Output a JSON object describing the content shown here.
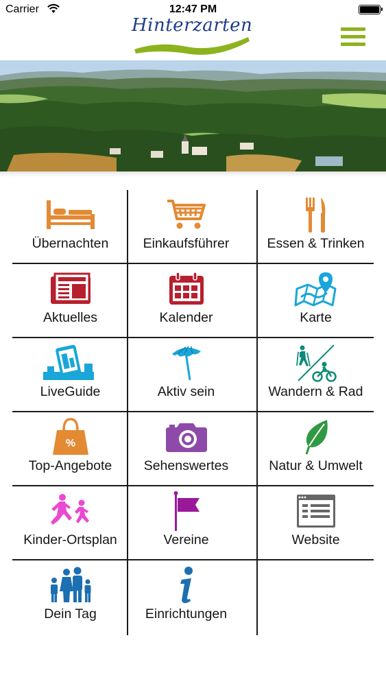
{
  "status_bar": {
    "carrier": "Carrier",
    "time": "12:47 PM"
  },
  "header": {
    "logo_text": "Hinterzarten"
  },
  "colors": {
    "accent_green": "#8cb31d",
    "logo_blue": "#1f3b8a",
    "orange": "#e38a33",
    "red": "#b7202e",
    "cyan": "#1aa6d8",
    "teal": "#0e8a7a",
    "purple": "#8e4aa8",
    "leaf_green": "#2f9a42",
    "pink": "#e94ad1",
    "magenta": "#9a199b",
    "gray": "#666666",
    "blue": "#1c6fb0"
  },
  "menu_items": [
    {
      "label": "Übernachten",
      "icon": "bed-icon"
    },
    {
      "label": "Einkaufsführer",
      "icon": "shopping-cart-icon"
    },
    {
      "label": "Essen & Trinken",
      "icon": "fork-knife-icon"
    },
    {
      "label": "Aktuelles",
      "icon": "newspaper-icon"
    },
    {
      "label": "Kalender",
      "icon": "calendar-icon"
    },
    {
      "label": "Karte",
      "icon": "map-pin-icon"
    },
    {
      "label": "LiveGuide",
      "icon": "phone-city-icon"
    },
    {
      "label": "Aktiv sein",
      "icon": "parasol-icon"
    },
    {
      "label": "Wandern & Rad",
      "icon": "hiker-cyclist-icon"
    },
    {
      "label": "Top-Angebote",
      "icon": "shopping-bag-percent-icon"
    },
    {
      "label": "Sehenswertes",
      "icon": "camera-icon"
    },
    {
      "label": "Natur & Umwelt",
      "icon": "leaf-icon"
    },
    {
      "label": "Kinder-Ortsplan",
      "icon": "running-kids-icon"
    },
    {
      "label": "Vereine",
      "icon": "flag-icon"
    },
    {
      "label": "Website",
      "icon": "browser-window-icon"
    },
    {
      "label": "Dein Tag",
      "icon": "family-icon"
    },
    {
      "label": "Einrichtungen",
      "icon": "info-icon"
    }
  ]
}
